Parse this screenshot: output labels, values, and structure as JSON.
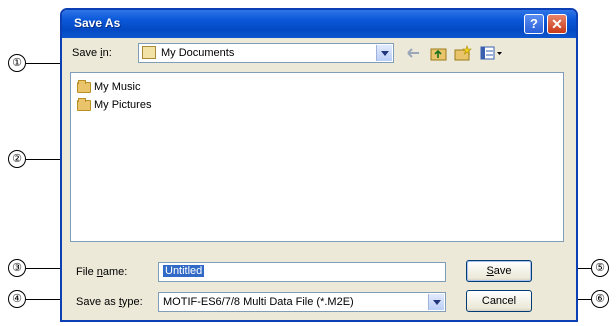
{
  "window": {
    "title": "Save As"
  },
  "toolbar": {
    "save_in_label": "Save in:",
    "save_in_value": "My Documents"
  },
  "files": [
    {
      "name": "My Music"
    },
    {
      "name": "My Pictures"
    }
  ],
  "filename": {
    "label": "File name:",
    "value": "Untitled"
  },
  "filetype": {
    "label": "Save as type:",
    "value": "MOTIF-ES6/7/8 Multi Data File (*.M2E)"
  },
  "buttons": {
    "save": "Save",
    "cancel": "Cancel"
  },
  "callouts": [
    "①",
    "②",
    "③",
    "④",
    "⑤",
    "⑥"
  ]
}
